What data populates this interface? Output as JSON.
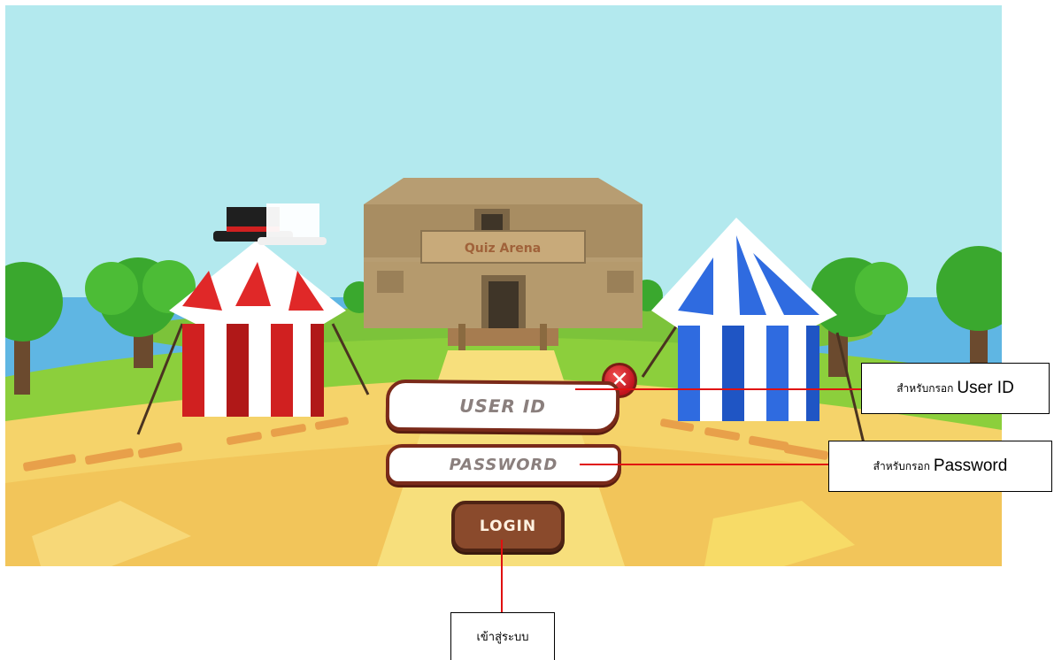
{
  "scene": {
    "building_sign": "Quiz Arena"
  },
  "login_form": {
    "user_id_label": "USER ID",
    "password_label": "PASSWORD",
    "login_label": "LOGIN",
    "close_glyph": "✕"
  },
  "annotations": {
    "user_id_prefix": "สำหรับกรอก",
    "user_id_term": "User ID",
    "password_prefix": "สำหรับกรอก",
    "password_term": "Password",
    "login_text": "เข้าสู่ระบบ"
  },
  "colors": {
    "sky": "#b3e9ee",
    "field_border": "#7a2a1a",
    "login_button": "#8a4a2c",
    "close_button": "#d01e24",
    "callout_line": "#e01010"
  }
}
